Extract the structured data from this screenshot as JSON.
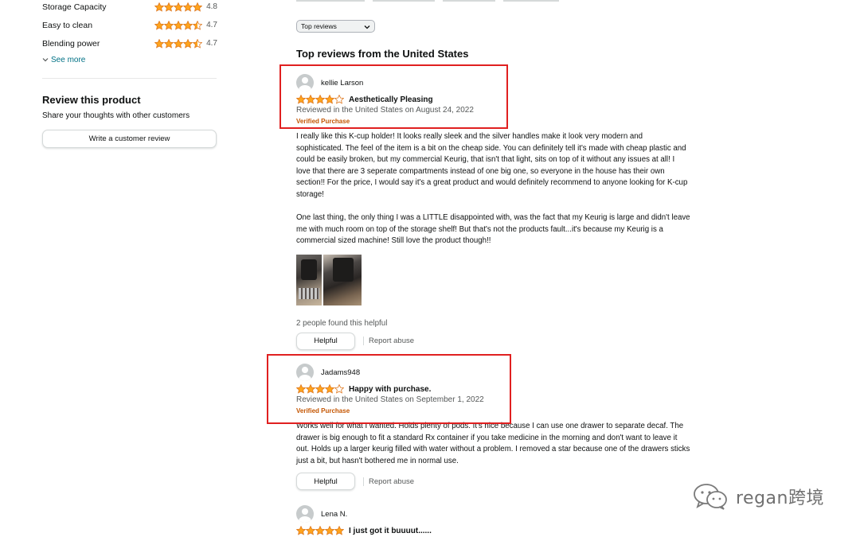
{
  "colors": {
    "star": "#ffa41c",
    "link": "#007185",
    "verified": "#c45500",
    "annotation": "#e02020"
  },
  "left": {
    "ratings": [
      {
        "label": "Storage Capacity",
        "value": "4.8",
        "stars": 5
      },
      {
        "label": "Easy to clean",
        "value": "4.7",
        "stars": 4.5
      },
      {
        "label": "Blending power",
        "value": "4.7",
        "stars": 4.5
      }
    ],
    "see_more": "See more",
    "see_more_icon": "chevron-down-icon",
    "review_heading": "Review this product",
    "review_sub": "Share your thoughts with other customers",
    "write_button": "Write a customer review"
  },
  "sort": {
    "selected": "Top reviews"
  },
  "section_title": "Top reviews from the United States",
  "reviews": [
    {
      "name": "kellie Larson",
      "rating": 4,
      "title": "Aesthetically Pleasing",
      "reviewed": "Reviewed in the United States on August 24, 2022",
      "verified": "Verified Purchase",
      "paragraphs": [
        "I really like this K-cup holder! It looks really sleek and the silver handles make it look very modern and sophisticated. The feel of the item is a bit on the cheap side. You can definitely tell it's made with cheap plastic and could be easily broken, but my commercial Keurig, that isn't that light, sits on top of it without any issues at all! I love that there are 3 seperate compartments instead of one big one, so everyone in the house has their own section!! For the price, I would say it's a great product and would definitely recommend to anyone looking for K-cup storage!",
        "One last thing, the only thing I was a LITTLE disappointed with, was the fact that my Keurig is large and didn't leave me with much room on top of the storage shelf! But that's not the products fault...it's because my Keurig is a commercial sized machine! Still love the product though!!"
      ],
      "helpful_count": "2 people found this helpful",
      "helpful_button": "Helpful",
      "report": "Report abuse"
    },
    {
      "name": "Jadams948",
      "rating": 4,
      "title": "Happy with purchase.",
      "reviewed": "Reviewed in the United States on September 1, 2022",
      "verified": "Verified Purchase",
      "paragraphs": [
        "Works well for what I wanted. Holds plenty of pods. It's nice because I can use one drawer to separate decaf. The drawer is big enough to fit a standard Rx container if you take medicine in the morning and don't want to leave it out. Holds up a larger keurig filled with water without a problem. I removed a star because one of the drawers sticks just a bit, but hasn't bothered me in normal use."
      ],
      "helpful_button": "Helpful",
      "report": "Report abuse"
    },
    {
      "name": "Lena N.",
      "rating": 5,
      "title": "I just got it buuuut......"
    }
  ],
  "watermark": {
    "text": "regan跨境",
    "icon": "wechat-icon"
  }
}
